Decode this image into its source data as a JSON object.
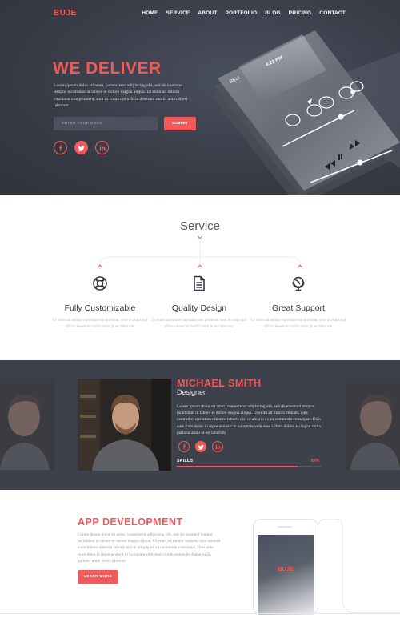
{
  "header": {
    "logo": "BUJE",
    "nav": [
      "HOME",
      "SERVICE",
      "ABOUT",
      "PORTFOLIO",
      "BLOG",
      "PRICING",
      "CONTACT"
    ]
  },
  "hero": {
    "title": "WE DELIVER",
    "text": "Lorem ipsum dolor sit amet, consectetur adipiscing elit, sed do eiusmod tempor incididunt ut labore et dolore magna aliqua. Ut enim ad minim cupidatat non proident, sunt in culpa qui officia deserunt mollit anim id est laborum.",
    "email_placeholder": "ENTER YOUR EMAIL",
    "submit_label": "SUBMIT",
    "social_icons": [
      "facebook-icon",
      "twitter-icon",
      "linkedin-icon"
    ],
    "phone": {
      "carrier": "BELL",
      "time": "4:21 PM"
    }
  },
  "service": {
    "title": "Service",
    "items": [
      {
        "icon": "lifebuoy-icon",
        "title": "Fully Customizable",
        "text": "Ut enim ad minim cupidatat non proident, sunt in culpa qui officia deserunt mollit anim id est laborum."
      },
      {
        "icon": "document-icon",
        "title": "Quality Design",
        "text": "Ut enim ad minim cupidatat non proident, sunt in culpa qui officia deserunt mollit anim id est laborum."
      },
      {
        "icon": "globe-icon",
        "title": "Great Support",
        "text": "Ut enim ad minim cupidatat non proident, sunt in culpa qui officia deserunt mollit anim id est laborum."
      }
    ]
  },
  "profile": {
    "name": "MICHAEL SMITH",
    "role": "Designer",
    "text": "Lorem ipsum dolor sit amet, consectetur adipiscing elit, sed do eiusmod tempor incididunt ut labore et dolore magna aliqua. Ut enim ad minim veniam, quis nostrud exercitation ullamco laboris nisi ut aliquip ex ea commodo consequat. Duis aute irure dolor in reprehenderit in voluptate velit esse cillum dolore eu fugiat nulla pariatur anim id est laborum",
    "skills_label": "SKILLS",
    "skills_value": "84%",
    "skills_fraction": 0.84
  },
  "app": {
    "title": "APP DEVELOPMENT",
    "text": "Lorem ipsum dolor sit amet, consectetur adipiscing elit, sed do eiusmod tempor incididunt ut labore et dolore magna aliqua. Ut enim ad minim veniam, quis nostrud exercitation ullamco laboris nisi ut aliquip ex ea commodo consequat. Duis aute irure dolor in reprehenderit in voluptate velit esse cillum dolore eu fugiat nulla pariatur anim id est laborum",
    "button_label": "LEARN MORE",
    "phone_logo": "BUJE"
  },
  "colors": {
    "accent": "#f05a5a",
    "dark": "#3d414c",
    "hero": "#393d48"
  }
}
